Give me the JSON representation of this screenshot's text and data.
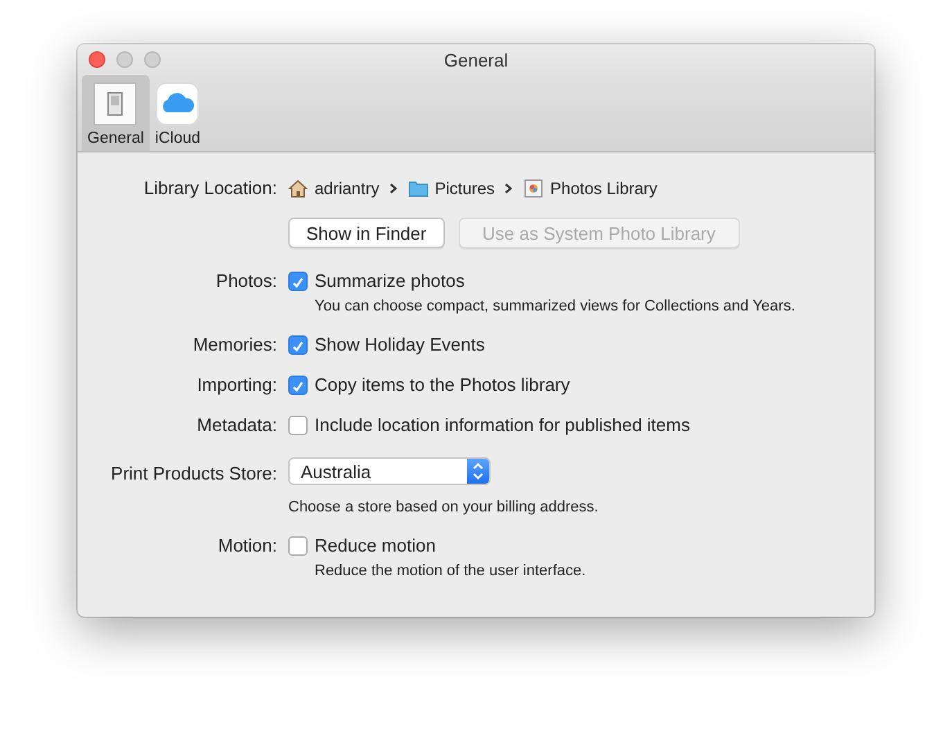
{
  "window": {
    "title": "General"
  },
  "tabs": [
    {
      "label": "General",
      "selected": true,
      "kind": "general"
    },
    {
      "label": "iCloud",
      "selected": false,
      "kind": "icloud"
    }
  ],
  "library_location": {
    "label": "Library Location:",
    "path": [
      {
        "kind": "home",
        "name": "adriantry"
      },
      {
        "kind": "folder",
        "name": "Pictures"
      },
      {
        "kind": "library",
        "name": "Photos Library"
      }
    ]
  },
  "buttons": [
    {
      "label": "Show in Finder",
      "disabled": false
    },
    {
      "label": "Use as System Photo Library",
      "disabled": true
    }
  ],
  "rows": [
    {
      "kind": "checkbox",
      "label": "Photos:",
      "text": "Summarize photos",
      "checked": true,
      "hint": "You can choose compact, summarized views for Collections and Years."
    },
    {
      "kind": "checkbox",
      "label": "Memories:",
      "text": "Show Holiday Events",
      "checked": true
    },
    {
      "kind": "checkbox",
      "label": "Importing:",
      "text": "Copy items to the Photos library",
      "checked": true
    },
    {
      "kind": "checkbox",
      "label": "Metadata:",
      "text": "Include location information for published items",
      "checked": false
    },
    {
      "kind": "popup",
      "label": "Print Products Store:",
      "value": "Australia",
      "hint": "Choose a store based on your billing address."
    },
    {
      "kind": "checkbox",
      "label": "Motion:",
      "text": "Reduce motion",
      "checked": false,
      "hint": "Reduce the motion of the user interface."
    }
  ]
}
